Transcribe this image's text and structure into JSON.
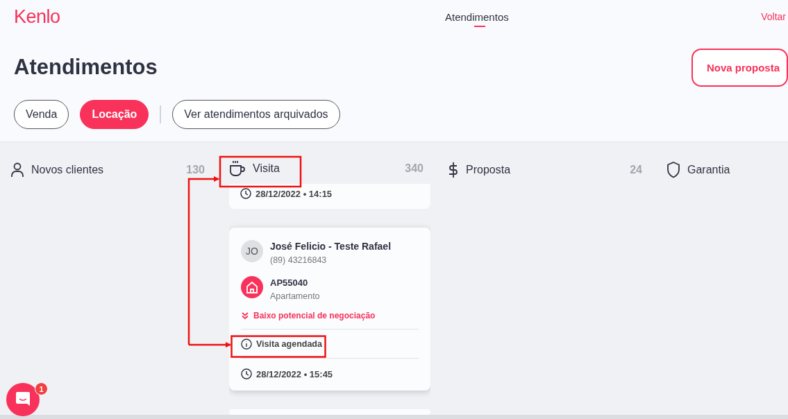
{
  "header": {
    "logo": "Kenlo",
    "nav": [
      {
        "label": "Atendimentos",
        "selected": true
      }
    ],
    "back_link": "Voltar"
  },
  "page": {
    "title": "Atendimentos",
    "new_button": "Nova proposta"
  },
  "filters": [
    {
      "label": "Venda",
      "selected": false
    },
    {
      "label": "Locação",
      "selected": true
    }
  ],
  "archived_button": "Ver atendimentos arquivados",
  "columns": [
    {
      "title": "Novos clientes",
      "count": "130",
      "kind": "person"
    },
    {
      "title": "Visita",
      "count": "340",
      "kind": "cup",
      "cards": [
        {
          "kind": "partial",
          "datetime": "28/12/2022 • 14:15"
        },
        {
          "kind": "full",
          "initials": "JO",
          "name": "José Felicio - Teste Rafael",
          "phone": "(89) 43216843",
          "property_code": "AP55040",
          "property_type": "Apartamento",
          "potential": "Baixo potencial de negociação",
          "status": "Visita agendada",
          "datetime": "28/12/2022 • 15:45"
        },
        {
          "kind": "stub"
        }
      ]
    },
    {
      "title": "Proposta",
      "count": "24",
      "kind": "dollar"
    },
    {
      "title": "Garantia",
      "kind": "shield"
    }
  ],
  "chat": {
    "badge": "1"
  }
}
